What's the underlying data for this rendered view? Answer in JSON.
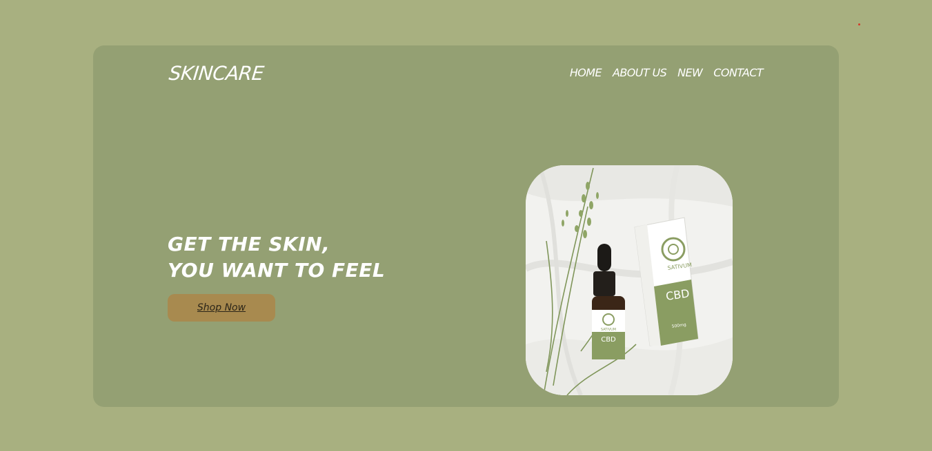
{
  "brand": {
    "logo_text": "SKINCARE"
  },
  "nav": {
    "items": [
      {
        "label": "HOME"
      },
      {
        "label": "ABOUT US"
      },
      {
        "label": "NEW"
      },
      {
        "label": "CONTACT"
      }
    ]
  },
  "hero": {
    "headline_line1": "GET THE SKIN,",
    "headline_line2": "YOU WANT TO FEEL",
    "cta_label": "Shop Now"
  },
  "product": {
    "brand_on_box": "SATIVUM",
    "label_on_box": "CBD",
    "brand_on_bottle": "SATIVUM",
    "label_on_bottle": "CBD",
    "strength": "500mg"
  },
  "colors": {
    "page_background": "#a8b080",
    "card_background": "#94a073",
    "cta_background": "#a88a4f",
    "text": "#ffffff"
  }
}
